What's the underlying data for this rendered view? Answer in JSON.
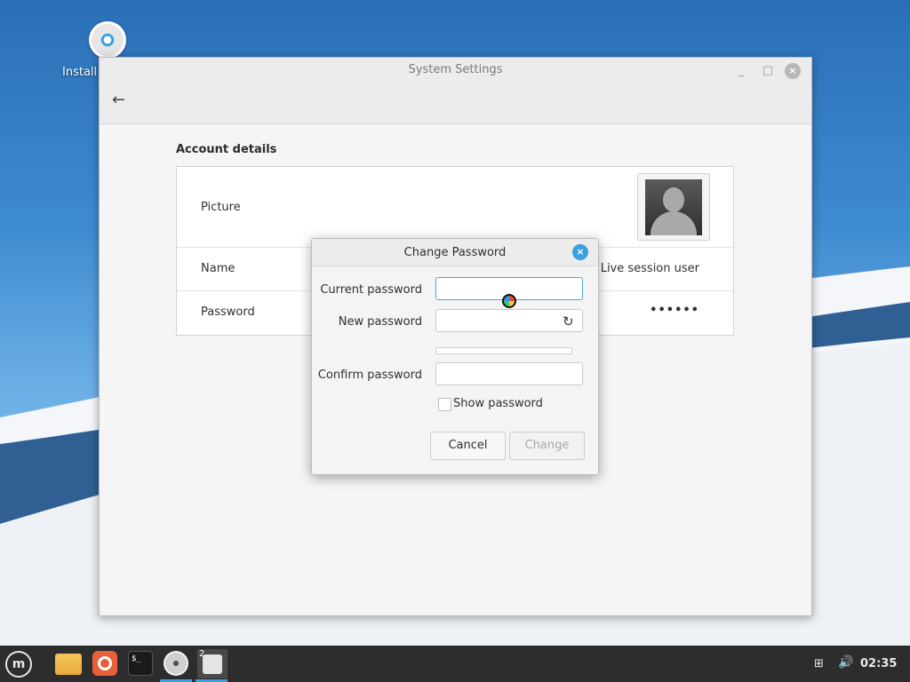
{
  "desktop": {
    "icon_label": "Install"
  },
  "window": {
    "title": "System Settings",
    "minimize": "_",
    "maximize": "□",
    "close": "×",
    "back": "←"
  },
  "account": {
    "section_title": "Account details",
    "rows": [
      {
        "label": "Picture"
      },
      {
        "label": "Name",
        "value": "Live session user"
      },
      {
        "label": "Password",
        "value": "••••••"
      }
    ]
  },
  "dialog": {
    "title": "Change Password",
    "close": "×",
    "current_label": "Current password",
    "new_label": "New password",
    "confirm_label": "Confirm password",
    "show_password_label": "Show password",
    "cancel_label": "Cancel",
    "change_label": "Change"
  },
  "taskbar": {
    "terminal_text": "$_",
    "workspace_number": "2",
    "clock": "02:35"
  },
  "colors": {
    "accent": "#3aa0e0"
  }
}
